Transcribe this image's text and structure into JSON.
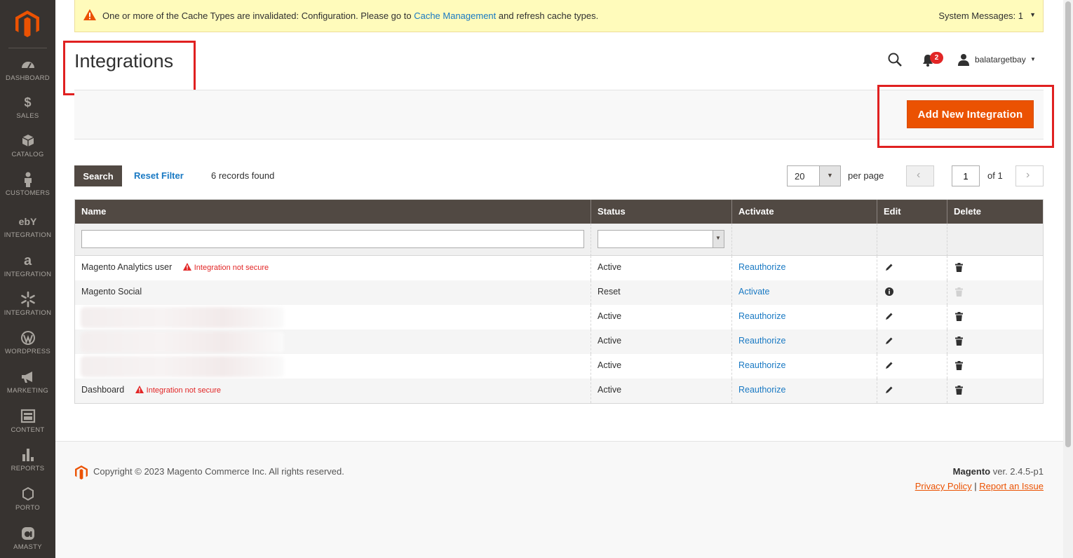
{
  "sidebar": {
    "items": [
      {
        "label": "DASHBOARD",
        "icon": "dashboard-icon"
      },
      {
        "label": "SALES",
        "icon": "dollar-icon"
      },
      {
        "label": "CATALOG",
        "icon": "box-icon"
      },
      {
        "label": "CUSTOMERS",
        "icon": "person-icon"
      },
      {
        "label": "INTEGRATION",
        "icon": "ebay-icon"
      },
      {
        "label": "INTEGRATION",
        "icon": "amazon-icon"
      },
      {
        "label": "INTEGRATION",
        "icon": "walmart-icon"
      },
      {
        "label": "WORDPRESS",
        "icon": "wordpress-icon"
      },
      {
        "label": "MARKETING",
        "icon": "megaphone-icon"
      },
      {
        "label": "CONTENT",
        "icon": "content-icon"
      },
      {
        "label": "REPORTS",
        "icon": "bar-chart-icon"
      },
      {
        "label": "PORTO",
        "icon": "hexagon-icon"
      },
      {
        "label": "AMASTY",
        "icon": "amasty-icon"
      }
    ],
    "glyphs": {
      "sales": "$",
      "ebay": "ebY",
      "amazon": "a"
    }
  },
  "system_message": {
    "text_before": "One or more of the Cache Types are invalidated: Configuration. Please go to ",
    "link": "Cache Management",
    "text_after": " and refresh cache types.",
    "count_label": "System Messages: 1"
  },
  "header": {
    "title": "Integrations",
    "notification_count": "2",
    "username": "balatargetbay"
  },
  "actions": {
    "add_button": "Add New Integration"
  },
  "toolbar": {
    "search_button": "Search",
    "reset_filter": "Reset Filter",
    "records_found": "6 records found",
    "per_page_value": "20",
    "per_page_label": "per page",
    "current_page": "1",
    "page_of": "of 1",
    "prev_glyph": "‹",
    "next_glyph": "›"
  },
  "grid": {
    "columns": [
      "Name",
      "Status",
      "Activate",
      "Edit",
      "Delete"
    ],
    "rows": [
      {
        "name": "Magento Analytics user",
        "warning": "Integration not secure",
        "status": "Active",
        "activate": "Reauthorize",
        "edit": "pencil-icon",
        "delete": "trash-icon"
      },
      {
        "name": "Magento Social",
        "warning": "",
        "status": "Reset",
        "activate": "Activate",
        "edit": "info-icon",
        "delete": "trash-disabled-icon"
      },
      {
        "name": "",
        "warning": "",
        "status": "Active",
        "activate": "Reauthorize",
        "edit": "pencil-icon",
        "delete": "trash-icon"
      },
      {
        "name": "",
        "warning": "",
        "status": "Active",
        "activate": "Reauthorize",
        "edit": "pencil-icon",
        "delete": "trash-icon"
      },
      {
        "name": "",
        "warning": "",
        "status": "Active",
        "activate": "Reauthorize",
        "edit": "pencil-icon",
        "delete": "trash-icon"
      },
      {
        "name": "Dashboard",
        "warning": "Integration not secure",
        "status": "Active",
        "activate": "Reauthorize",
        "edit": "pencil-icon",
        "delete": "trash-icon"
      }
    ]
  },
  "footer": {
    "copyright": "Copyright © 2023 Magento Commerce Inc. All rights reserved.",
    "brand": "Magento",
    "version": " ver. 2.4.5-p1",
    "privacy": "Privacy Policy",
    "separator": " | ",
    "report": "Report an Issue"
  },
  "colors": {
    "accent": "#eb5202",
    "sidebar": "#373330",
    "grid_header": "#514943",
    "link": "#1979c3",
    "warning": "#e22626"
  }
}
